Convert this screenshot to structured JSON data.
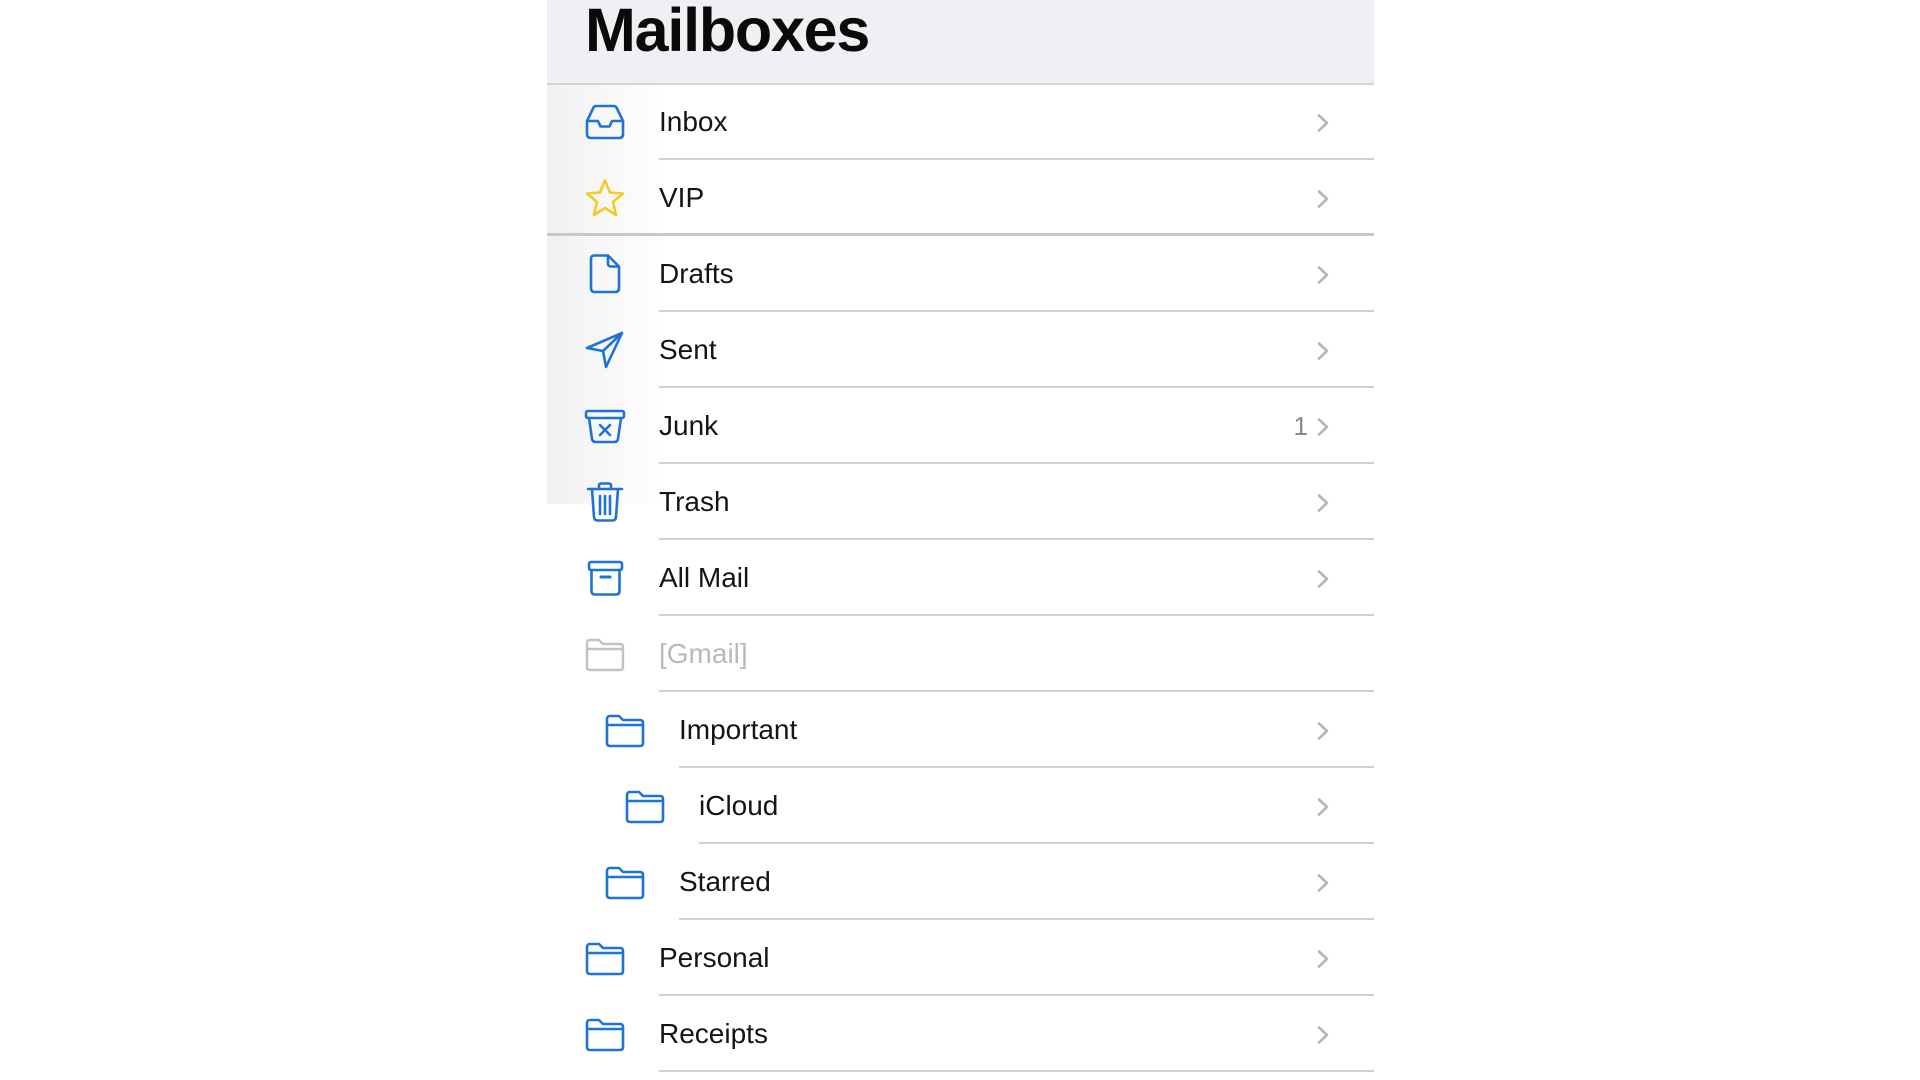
{
  "header": {
    "title": "Mailboxes"
  },
  "colors": {
    "accent": "#1f73d4",
    "vip": "#f0cc25",
    "disabled": "#b9b9bd",
    "chevron": "#b5b5ba"
  },
  "mailboxes": [
    {
      "label": "Inbox",
      "icon": "inbox-icon",
      "level": 0,
      "count": "",
      "chevron": true,
      "disabled": false
    },
    {
      "label": "VIP",
      "icon": "star-icon",
      "level": 0,
      "count": "",
      "chevron": true,
      "disabled": false
    },
    {
      "label": "Drafts",
      "icon": "document-icon",
      "level": 0,
      "count": "",
      "chevron": true,
      "disabled": false
    },
    {
      "label": "Sent",
      "icon": "paper-plane-icon",
      "level": 0,
      "count": "",
      "chevron": true,
      "disabled": false
    },
    {
      "label": "Junk",
      "icon": "junk-bin-icon",
      "level": 0,
      "count": "1",
      "chevron": true,
      "disabled": false
    },
    {
      "label": "Trash",
      "icon": "trash-icon",
      "level": 0,
      "count": "",
      "chevron": true,
      "disabled": false
    },
    {
      "label": "All Mail",
      "icon": "archive-box-icon",
      "level": 0,
      "count": "",
      "chevron": true,
      "disabled": false
    },
    {
      "label": "[Gmail]",
      "icon": "folder-icon",
      "level": 0,
      "count": "",
      "chevron": false,
      "disabled": true
    },
    {
      "label": "Important",
      "icon": "folder-icon",
      "level": 1,
      "count": "",
      "chevron": true,
      "disabled": false
    },
    {
      "label": "iCloud",
      "icon": "folder-icon",
      "level": 2,
      "count": "",
      "chevron": true,
      "disabled": false
    },
    {
      "label": "Starred",
      "icon": "folder-icon",
      "level": 1,
      "count": "",
      "chevron": true,
      "disabled": false
    },
    {
      "label": "Personal",
      "icon": "folder-icon",
      "level": 0,
      "count": "",
      "chevron": true,
      "disabled": false
    },
    {
      "label": "Receipts",
      "icon": "folder-icon",
      "level": 0,
      "count": "",
      "chevron": true,
      "disabled": false
    }
  ]
}
